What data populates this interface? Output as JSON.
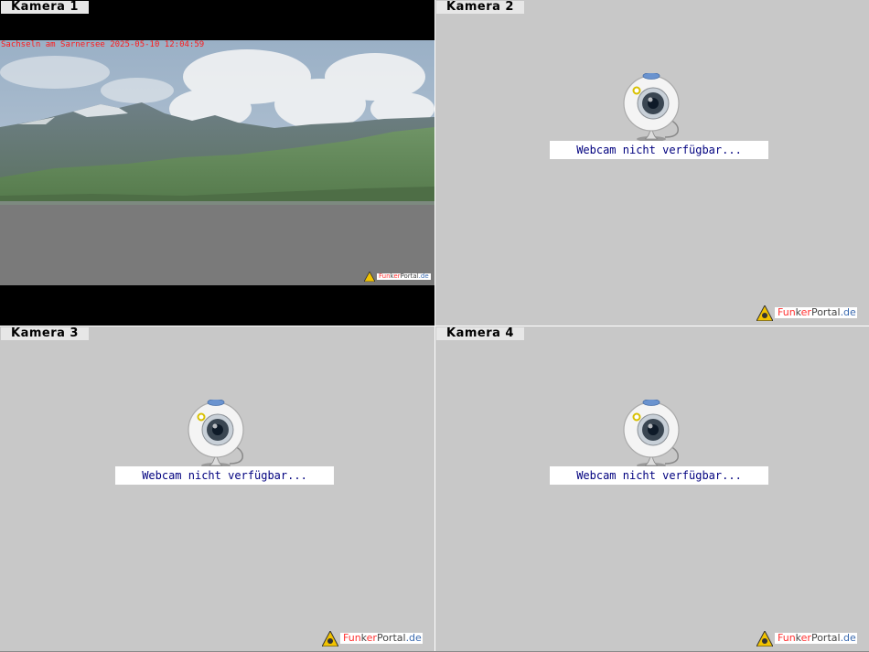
{
  "cameras": [
    {
      "label": "Kamera 1",
      "overlay": "Sachseln am Sarnersee 2025-05-10 12:04:59",
      "status": "live"
    },
    {
      "label": "Kamera 2",
      "status": "unavailable"
    },
    {
      "label": "Kamera 3",
      "status": "unavailable"
    },
    {
      "label": "Kamera 4",
      "status": "unavailable"
    }
  ],
  "unavailable_message": "Webcam nicht verfügbar...",
  "watermark": {
    "part1": "Fun",
    "part2": "k",
    "part3": "er",
    "part4": "Portal",
    "part5": ".de"
  },
  "icons": {
    "webcam": "webcam-icon",
    "watermark": "warning-triangle-icon"
  },
  "colors": {
    "overlay_text": "#ff1a1a",
    "message_text": "#00007f",
    "panel_bg": "#c8c8c8"
  }
}
